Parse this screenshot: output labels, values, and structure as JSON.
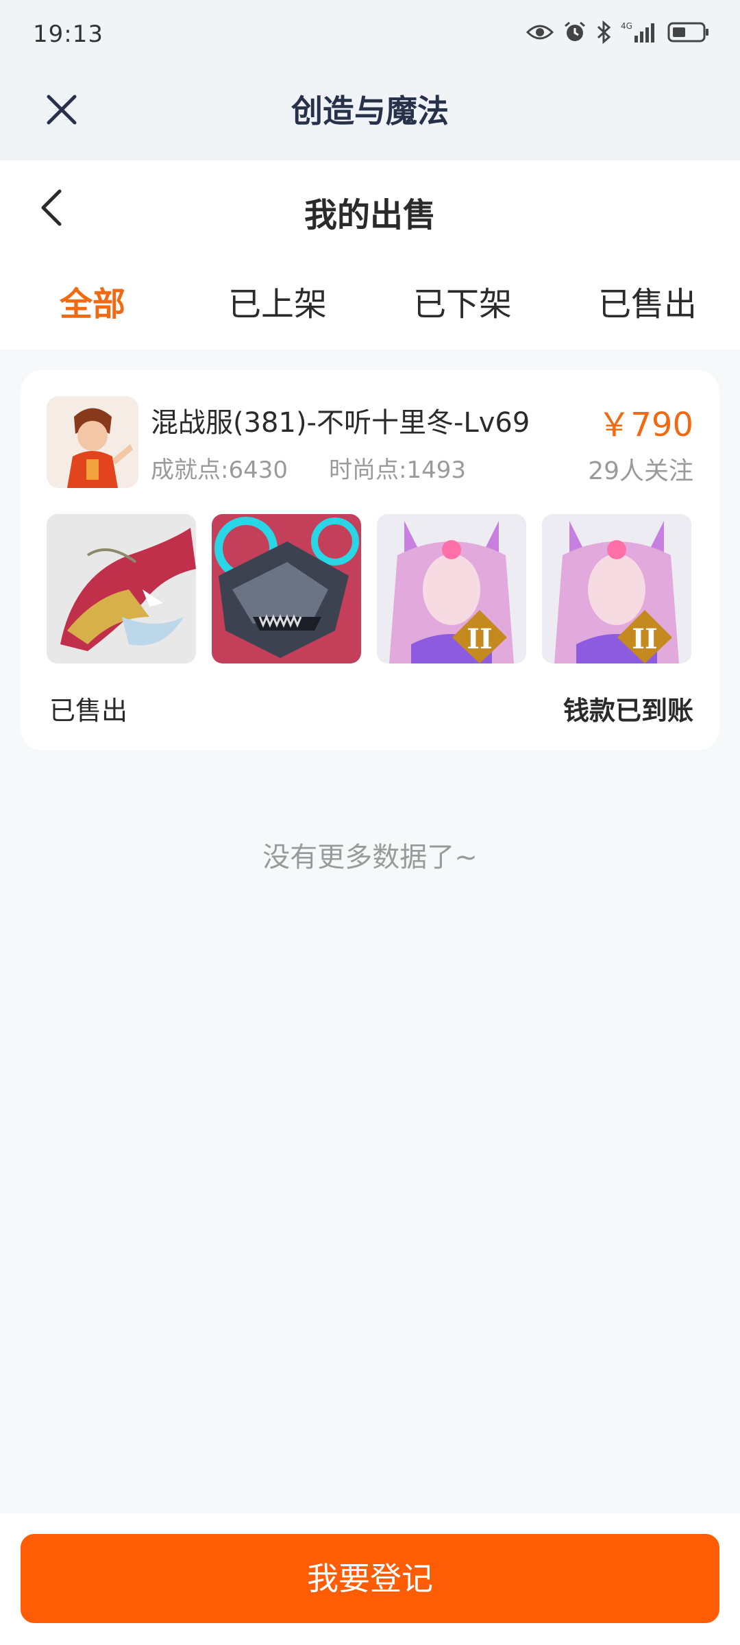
{
  "status_bar": {
    "time": "19:13",
    "icons": [
      "eye-icon",
      "alarm-icon",
      "bluetooth-icon",
      "signal-4g-icon",
      "battery-icon"
    ]
  },
  "mini_program": {
    "title": "创造与魔法",
    "close_icon": "close-icon"
  },
  "page": {
    "title": "我的出售",
    "back_icon": "back-arrow-icon"
  },
  "tabs": [
    {
      "label": "全部",
      "active": true
    },
    {
      "label": "已上架",
      "active": false
    },
    {
      "label": "已下架",
      "active": false
    },
    {
      "label": "已售出",
      "active": false
    }
  ],
  "listing": {
    "title": "混战服(381)-不听十里冬-Lv69",
    "achievement": "成就点:6430",
    "fashion": "时尚点:1493",
    "price": "￥790",
    "followers": "29人关注",
    "sale_status": "已售出",
    "payment_status": "钱款已到账",
    "thumbnails": [
      "dragon-mount-image",
      "mech-wolf-mount-image",
      "fox-girl-skin-image",
      "fox-girl-skin-image"
    ]
  },
  "footer_note": "没有更多数据了~",
  "cta": {
    "label": "我要登记"
  },
  "colors": {
    "accent": "#ef6a12",
    "cta_background": "#ff5d05",
    "page_background": "#f6f8fa",
    "header_background": "#f1f4f7"
  }
}
